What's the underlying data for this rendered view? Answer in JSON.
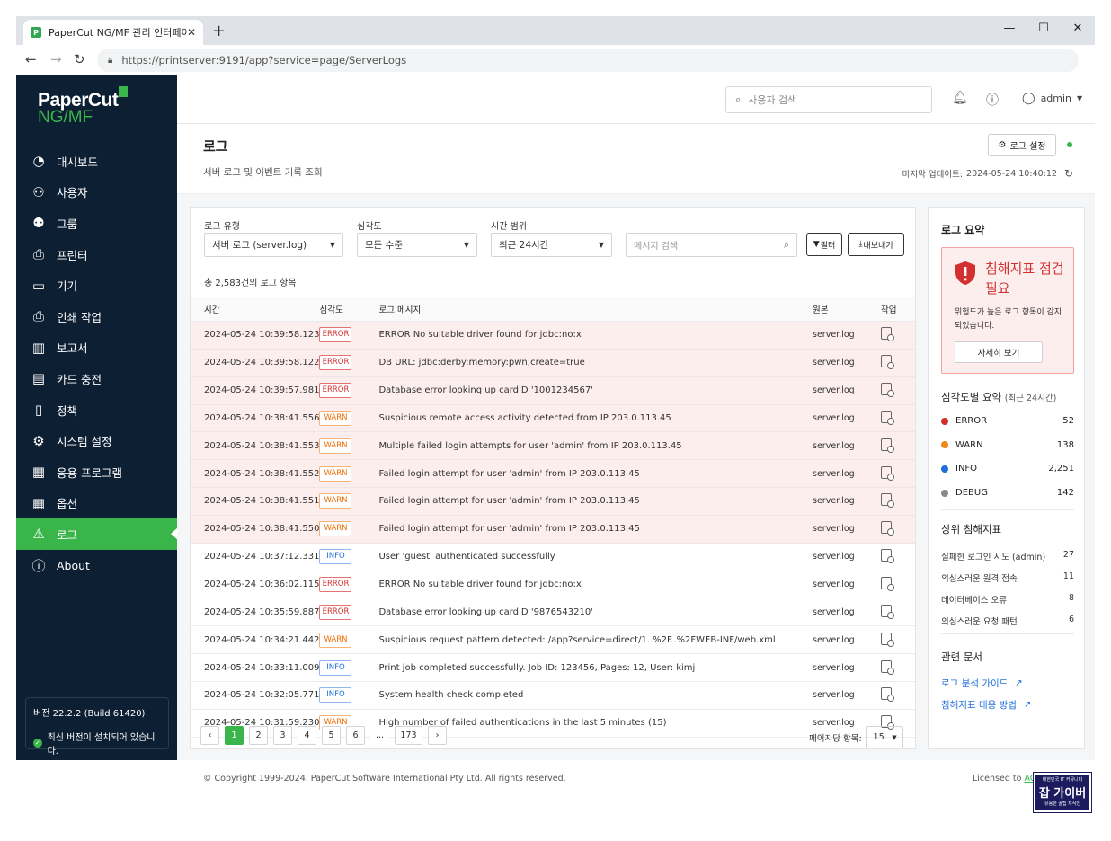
{
  "browser": {
    "tab_title": "PaperCut NG/MF 관리 인터페이스",
    "tab_close": "✕",
    "new_tab": "+",
    "url": "https://printserver:9191/app?service=page/ServerLogs"
  },
  "sidebar": {
    "logo_line1": "PaperCut",
    "logo_line2": "NG/MF",
    "items": [
      {
        "label": "대시보드",
        "icon": "dashboard-icon"
      },
      {
        "label": "사용자",
        "icon": "user-icon"
      },
      {
        "label": "그룹",
        "icon": "group-icon"
      },
      {
        "label": "프린터",
        "icon": "printer-icon"
      },
      {
        "label": "기기",
        "icon": "device-icon"
      },
      {
        "label": "인쇄 작업",
        "icon": "print-job-icon"
      },
      {
        "label": "보고서",
        "icon": "report-icon"
      },
      {
        "label": "카드 충전",
        "icon": "card-icon"
      },
      {
        "label": "정책",
        "icon": "policy-icon"
      },
      {
        "label": "시스템 설정",
        "icon": "settings-icon"
      },
      {
        "label": "응용 프로그램",
        "icon": "apps-icon"
      },
      {
        "label": "옵션",
        "icon": "options-icon"
      },
      {
        "label": "로그",
        "icon": "log-icon"
      },
      {
        "label": "About",
        "icon": "info-icon"
      }
    ],
    "active_index": 12,
    "version": "버전 22.2.2 (Build 61420)",
    "version_status": "최신 버전이 설치되어 있습니다."
  },
  "topbar": {
    "search_placeholder": "사용자 검색",
    "user": "admin"
  },
  "page": {
    "title": "로그",
    "subtitle": "서버 로그 및 이벤트 기록 조회",
    "settings_button": "로그 설정",
    "last_update_label": "마지막 업데이트:",
    "last_update_value": "2024-05-24 10:40:12"
  },
  "filters": {
    "log_type_label": "로그 유형",
    "log_type_value": "서버 로그 (server.log)",
    "severity_label": "심각도",
    "severity_value": "모든 수준",
    "time_label": "시간 범위",
    "time_value": "최근 24시간",
    "message_placeholder": "메시지 검색",
    "filter_button": "필터",
    "export_button": "내보내기"
  },
  "table": {
    "total": "총 2,583건의 로그 항목",
    "headers": [
      "시간",
      "심각도",
      "로그 메시지",
      "원본",
      "작업"
    ],
    "rows": [
      {
        "time": "2024-05-24 10:39:58.123",
        "sev": "ERROR",
        "msg": "ERROR No suitable driver found for jdbc:no:x",
        "src": "server.log"
      },
      {
        "time": "2024-05-24 10:39:58.122",
        "sev": "ERROR",
        "msg": "DB URL: jdbc:derby:memory:pwn;create=true",
        "src": "server.log"
      },
      {
        "time": "2024-05-24 10:39:57.981",
        "sev": "ERROR",
        "msg": "Database error looking up cardID '1001234567'",
        "src": "server.log"
      },
      {
        "time": "2024-05-24 10:38:41.556",
        "sev": "WARN",
        "msg": "Suspicious remote access activity detected from IP 203.0.113.45",
        "src": "server.log"
      },
      {
        "time": "2024-05-24 10:38:41.553",
        "sev": "WARN",
        "msg": "Multiple failed login attempts for user 'admin' from IP 203.0.113.45",
        "src": "server.log"
      },
      {
        "time": "2024-05-24 10:38:41.552",
        "sev": "WARN",
        "msg": "Failed login attempt for user 'admin' from IP 203.0.113.45",
        "src": "server.log"
      },
      {
        "time": "2024-05-24 10:38:41.551",
        "sev": "WARN",
        "msg": "Failed login attempt for user 'admin' from IP 203.0.113.45",
        "src": "server.log"
      },
      {
        "time": "2024-05-24 10:38:41.550",
        "sev": "WARN",
        "msg": "Failed login attempt for user 'admin' from IP 203.0.113.45",
        "src": "server.log"
      },
      {
        "time": "2024-05-24 10:37:12.331",
        "sev": "INFO",
        "msg": "User 'guest' authenticated successfully",
        "src": "server.log"
      },
      {
        "time": "2024-05-24 10:36:02.115",
        "sev": "ERROR",
        "msg": "ERROR No suitable driver found for jdbc:no:x",
        "src": "server.log"
      },
      {
        "time": "2024-05-24 10:35:59.887",
        "sev": "ERROR",
        "msg": "Database error looking up cardID '9876543210'",
        "src": "server.log"
      },
      {
        "time": "2024-05-24 10:34:21.442",
        "sev": "WARN",
        "msg": "Suspicious request pattern detected: /app?service=direct/1..%2F..%2FWEB-INF/web.xml",
        "src": "server.log"
      },
      {
        "time": "2024-05-24 10:33:11.009",
        "sev": "INFO",
        "msg": "Print job completed successfully. Job ID: 123456, Pages: 12, User: kimj",
        "src": "server.log"
      },
      {
        "time": "2024-05-24 10:32:05.771",
        "sev": "INFO",
        "msg": "System health check completed",
        "src": "server.log"
      },
      {
        "time": "2024-05-24 10:31:59.230",
        "sev": "WARN",
        "msg": "High number of failed authentications in the last 5 minutes (15)",
        "src": "server.log"
      }
    ],
    "highlighted_rows": 8
  },
  "pagination": {
    "prev": "‹",
    "next": "›",
    "pages": [
      "1",
      "2",
      "3",
      "4",
      "5",
      "6",
      "...",
      "173"
    ],
    "active": "1",
    "per_page_label": "페이지당 항목:",
    "per_page_value": "15"
  },
  "summary": {
    "title": "로그 요약",
    "alert_title": "침해지표 점검 필요",
    "alert_desc": "위험도가 높은 로그 항목이 감지되었습니다.",
    "alert_button": "자세히 보기",
    "severity_title": "심각도별 요약",
    "severity_sub": "(최근 24시간)",
    "severity": [
      {
        "name": "ERROR",
        "count": "52",
        "color": "#d32f2f"
      },
      {
        "name": "WARN",
        "count": "138",
        "color": "#ef8a1a"
      },
      {
        "name": "INFO",
        "count": "2,251",
        "color": "#1e6fd9"
      },
      {
        "name": "DEBUG",
        "count": "142",
        "color": "#8a8a8a"
      }
    ],
    "indicators_title": "상위 침해지표",
    "indicators": [
      {
        "name": "실패한 로그인 시도 (admin)",
        "count": "27"
      },
      {
        "name": "의심스러운 원격 접속",
        "count": "11"
      },
      {
        "name": "데이터베이스 오류",
        "count": "8"
      },
      {
        "name": "의심스러운 요청 패턴",
        "count": "6"
      }
    ],
    "docs_title": "관련 문서",
    "docs": [
      "로그 분석 가이드",
      "침해지표 대응 방법"
    ]
  },
  "footer": {
    "copyright": "© Copyright 1999-2024. PaperCut Software International Pty Ltd. All rights reserved.",
    "licensed_label": "Licensed to",
    "licensed_value": "AC"
  },
  "watermark": {
    "top": "대한민국 IT 커뮤니티",
    "mid": "잡 가이버",
    "bot": "유용한 꿀팁 지식인"
  },
  "colors": {
    "sidebar": "#0d1f33",
    "accent": "#3ab54a",
    "error": "#d32f2f",
    "warn": "#ef6c00",
    "info": "#1e6fd9"
  }
}
